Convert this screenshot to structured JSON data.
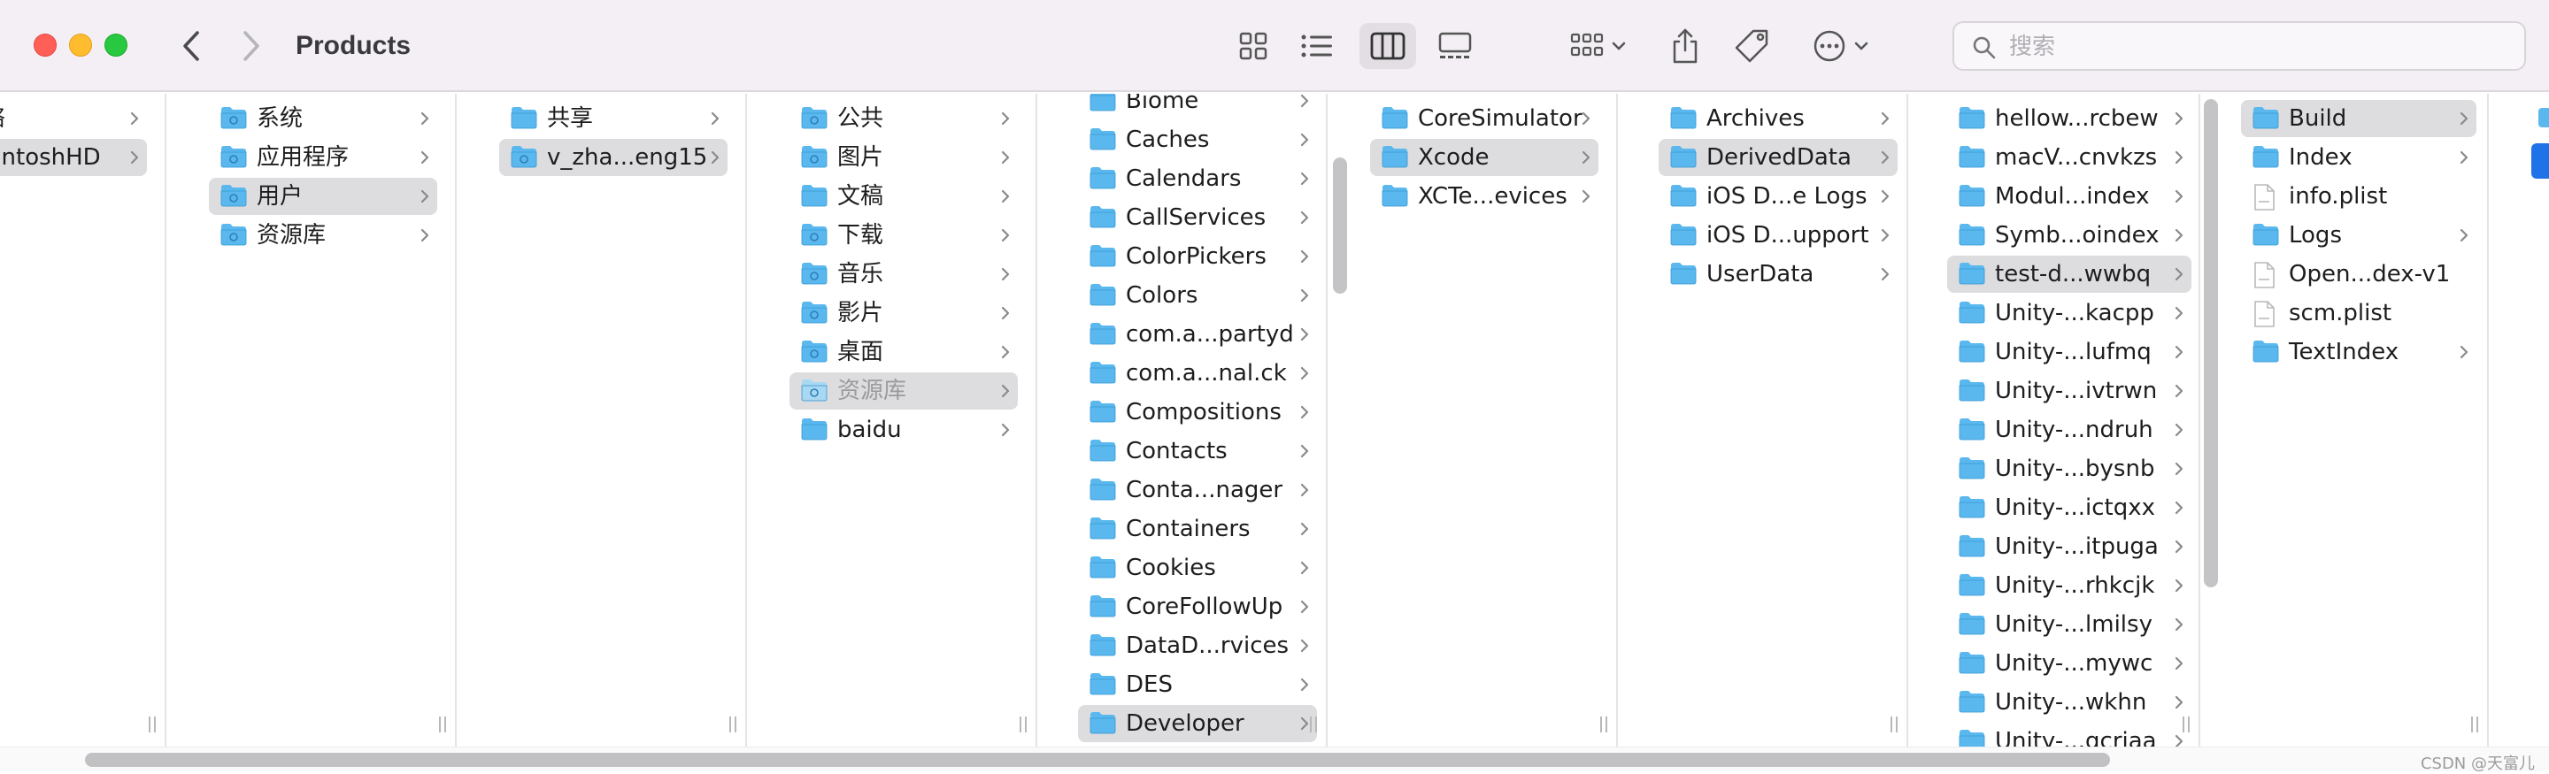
{
  "window": {
    "title": "Products"
  },
  "toolbar": {
    "view_modes": [
      "icon-view",
      "list-view",
      "column-view",
      "gallery-view"
    ],
    "active_view": "column-view",
    "search_placeholder": "搜索"
  },
  "colors": {
    "folder_blue": "#5ab8ee",
    "selection": "#dddcde",
    "accent": "#1f72e8"
  },
  "columns": [
    {
      "items": [
        {
          "label": "络",
          "selected": false
        },
        {
          "label": "cintoshHD",
          "selected": true
        }
      ]
    },
    {
      "items": [
        {
          "label": "系统",
          "selected": false
        },
        {
          "label": "应用程序",
          "selected": false
        },
        {
          "label": "用户",
          "selected": true
        },
        {
          "label": "资源库",
          "selected": false
        }
      ]
    },
    {
      "items": [
        {
          "label": "共享",
          "selected": false
        },
        {
          "label": "v_zha...eng15",
          "selected": true
        }
      ]
    },
    {
      "items": [
        {
          "label": "公共"
        },
        {
          "label": "图片"
        },
        {
          "label": "文稿"
        },
        {
          "label": "下载"
        },
        {
          "label": "音乐"
        },
        {
          "label": "影片"
        },
        {
          "label": "桌面"
        },
        {
          "label": "资源库",
          "selected": true,
          "dim": true
        },
        {
          "label": "baidu"
        }
      ]
    },
    {
      "items": [
        {
          "label": "Biome"
        },
        {
          "label": "Caches"
        },
        {
          "label": "Calendars"
        },
        {
          "label": "CallServices"
        },
        {
          "label": "ColorPickers"
        },
        {
          "label": "Colors"
        },
        {
          "label": "com.a...partyd"
        },
        {
          "label": "com.a...nal.ck"
        },
        {
          "label": "Compositions"
        },
        {
          "label": "Contacts"
        },
        {
          "label": "Conta...nager"
        },
        {
          "label": "Containers"
        },
        {
          "label": "Cookies"
        },
        {
          "label": "CoreFollowUp"
        },
        {
          "label": "DataD...rvices"
        },
        {
          "label": "DES"
        },
        {
          "label": "Developer",
          "selected": true
        }
      ]
    },
    {
      "items": [
        {
          "label": "CoreSimulator"
        },
        {
          "label": "Xcode",
          "selected": true
        },
        {
          "label": "XCTe...evices"
        }
      ]
    },
    {
      "items": [
        {
          "label": "Archives"
        },
        {
          "label": "DerivedData",
          "selected": true
        },
        {
          "label": "iOS D...e Logs"
        },
        {
          "label": "iOS D...upport"
        },
        {
          "label": "UserData"
        }
      ]
    },
    {
      "items": [
        {
          "label": "hellow...rcbew"
        },
        {
          "label": "macV...cnvkzs"
        },
        {
          "label": "Modul...index"
        },
        {
          "label": "Symb...oindex"
        },
        {
          "label": "test-d...wwbq",
          "selected": true
        },
        {
          "label": "Unity-...kacpp"
        },
        {
          "label": "Unity-...lufmq"
        },
        {
          "label": "Unity-...ivtrwn"
        },
        {
          "label": "Unity-...ndruh"
        },
        {
          "label": "Unity-...bysnb"
        },
        {
          "label": "Unity-...ictqxx"
        },
        {
          "label": "Unity-...itpuga"
        },
        {
          "label": "Unity-...rhkcjk"
        },
        {
          "label": "Unity-...lmilsy"
        },
        {
          "label": "Unity-...mywc"
        },
        {
          "label": "Unity-...wkhn"
        },
        {
          "label": "Unity-...gcriaa"
        }
      ]
    },
    {
      "items": [
        {
          "label": "Build",
          "selected": true,
          "folder": true
        },
        {
          "label": "Index",
          "folder": true
        },
        {
          "label": "info.plist",
          "folder": false
        },
        {
          "label": "Logs",
          "folder": true
        },
        {
          "label": "Open...dex-v1",
          "folder": false
        },
        {
          "label": "scm.plist",
          "folder": false
        },
        {
          "label": "TextIndex",
          "folder": true
        }
      ]
    }
  ],
  "watermark": "CSDN @天富儿"
}
